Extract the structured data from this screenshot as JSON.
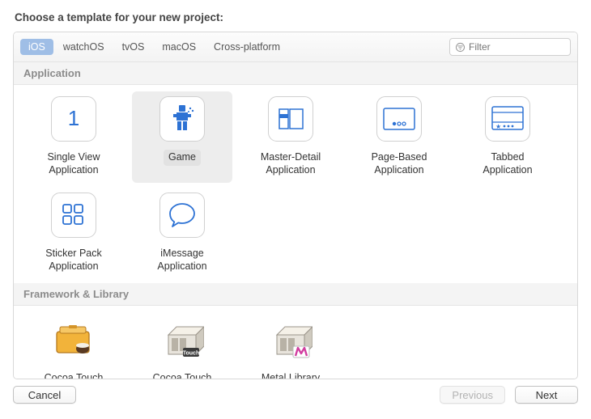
{
  "heading": "Choose a template for your new project:",
  "platforms": {
    "items": [
      "iOS",
      "watchOS",
      "tvOS",
      "macOS",
      "Cross-platform"
    ],
    "selected": 0
  },
  "filter": {
    "placeholder": "Filter",
    "value": ""
  },
  "sections": [
    {
      "title": "Application",
      "templates": [
        {
          "id": "single-view",
          "label": "Single View\nApplication",
          "icon": "single-view-icon",
          "selected": false
        },
        {
          "id": "game",
          "label": "Game",
          "icon": "game-icon",
          "selected": true
        },
        {
          "id": "master-detail",
          "label": "Master-Detail\nApplication",
          "icon": "master-detail-icon",
          "selected": false
        },
        {
          "id": "page-based",
          "label": "Page-Based\nApplication",
          "icon": "page-based-icon",
          "selected": false
        },
        {
          "id": "tabbed",
          "label": "Tabbed\nApplication",
          "icon": "tabbed-icon",
          "selected": false
        },
        {
          "id": "sticker-pack",
          "label": "Sticker Pack\nApplication",
          "icon": "sticker-pack-icon",
          "selected": false
        },
        {
          "id": "imessage",
          "label": "iMessage\nApplication",
          "icon": "imessage-icon",
          "selected": false
        }
      ]
    },
    {
      "title": "Framework & Library",
      "templates": [
        {
          "id": "cocoa-touch-framework",
          "label": "Cocoa Touch\nFramework",
          "icon": "framework-icon",
          "selected": false
        },
        {
          "id": "cocoa-touch-static",
          "label": "Cocoa Touch\nStatic Library",
          "icon": "static-lib-icon",
          "selected": false
        },
        {
          "id": "metal-library",
          "label": "Metal Library",
          "icon": "metal-lib-icon",
          "selected": false
        }
      ]
    }
  ],
  "buttons": {
    "cancel": {
      "label": "Cancel",
      "enabled": true
    },
    "previous": {
      "label": "Previous",
      "enabled": false
    },
    "next": {
      "label": "Next",
      "enabled": true
    }
  }
}
